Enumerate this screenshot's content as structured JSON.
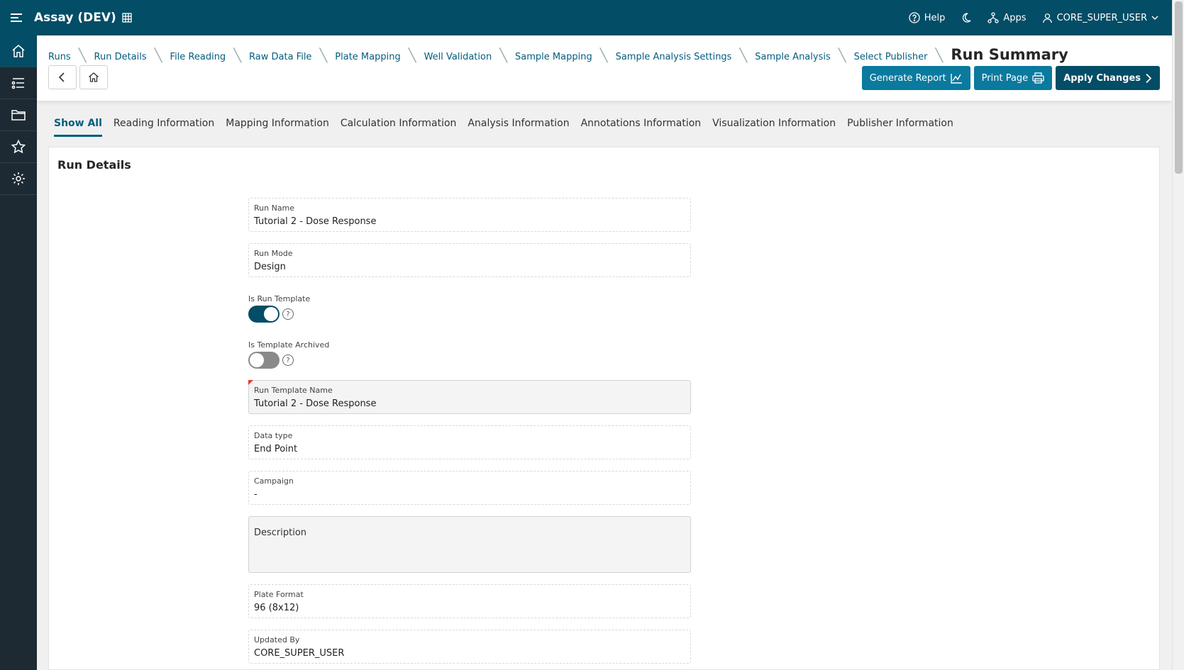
{
  "app": {
    "title": "Assay (DEV)"
  },
  "topbar": {
    "help_label": "Help",
    "apps_label": "Apps",
    "user_label": "CORE_SUPER_USER"
  },
  "breadcrumb": {
    "items": [
      "Runs",
      "Run Details",
      "File Reading",
      "Raw Data File",
      "Plate Mapping",
      "Well Validation",
      "Sample Mapping",
      "Sample Analysis Settings",
      "Sample Analysis",
      "Select Publisher"
    ],
    "current": "Run Summary"
  },
  "actions": {
    "generate_report": "Generate Report",
    "print_page": "Print Page",
    "apply_changes": "Apply Changes"
  },
  "tabs": [
    "Show All",
    "Reading Information",
    "Mapping Information",
    "Calculation Information",
    "Analysis Information",
    "Annotations Information",
    "Visualization Information",
    "Publisher Information"
  ],
  "panel": {
    "title": "Run Details",
    "run_name": {
      "label": "Run Name",
      "value": "Tutorial 2 - Dose Response"
    },
    "run_mode": {
      "label": "Run Mode",
      "value": "Design"
    },
    "is_run_template": {
      "label": "Is Run Template",
      "on": true
    },
    "is_template_archived": {
      "label": "Is Template Archived",
      "on": false
    },
    "run_template_name": {
      "label": "Run Template Name",
      "value": "Tutorial 2 - Dose Response"
    },
    "data_type": {
      "label": "Data type",
      "value": "End Point"
    },
    "campaign": {
      "label": "Campaign",
      "value": "-"
    },
    "description": {
      "placeholder": "Description"
    },
    "plate_format": {
      "label": "Plate Format",
      "value": "96 (8x12)"
    },
    "updated_by": {
      "label": "Updated By",
      "value": "CORE_SUPER_USER"
    }
  },
  "help_glyph": "?",
  "colors": {
    "topbar": "#034d66",
    "accent": "#045d7e",
    "button": "#0a7a9e",
    "required": "#e8392b"
  }
}
